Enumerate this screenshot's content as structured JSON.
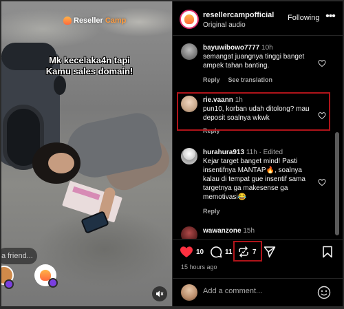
{
  "video": {
    "brand_name": "Reseller",
    "brand_accent": "Camp",
    "caption": "Mk kecelaka4n tapi Kamu sales domain!",
    "share_placeholder": "a friend...",
    "mute_icon": "mute-icon"
  },
  "post": {
    "username": "resellercampofficial",
    "subtitle": "Original audio",
    "follow_label": "Following",
    "more_label": "•••"
  },
  "comments": [
    {
      "username": "bayuwibowo7777",
      "time": "10h",
      "text": "semangat juangnya tinggi banget ampek tahan banting.",
      "reply_label": "Reply",
      "translation_label": "See translation",
      "avatar_color": "#8a8a8a"
    },
    {
      "username": "rie.vaann",
      "time": "1h",
      "text": "pun10, korban udah ditolong? mau deposit soalnya wkwk",
      "reply_label": "Reply",
      "avatar_color": "#c9a98c"
    },
    {
      "username": "hurahura913",
      "time": "11h",
      "edited": "· Edited",
      "text": "Kejar target banget mind! Pasti insentifnya MANTAP🔥, soalnya kalau di tempat gue insentif sama targetnya ga makesense ga memotivasi😂",
      "reply_label": "Reply",
      "avatar_color": "#dcdcdc"
    },
    {
      "username": "wawanzone",
      "time": "15h",
      "avatar_color": "#5a1e1e"
    }
  ],
  "actions": {
    "likes": "10",
    "comments": "11",
    "reposts": "7",
    "timestamp": "15 hours ago",
    "like_color": "#ff3040"
  },
  "composer": {
    "placeholder": "Add a comment..."
  },
  "colors": {
    "highlight": "#b0141a",
    "panel_bg": "#000000",
    "secondary_text": "#a8a8a8"
  }
}
